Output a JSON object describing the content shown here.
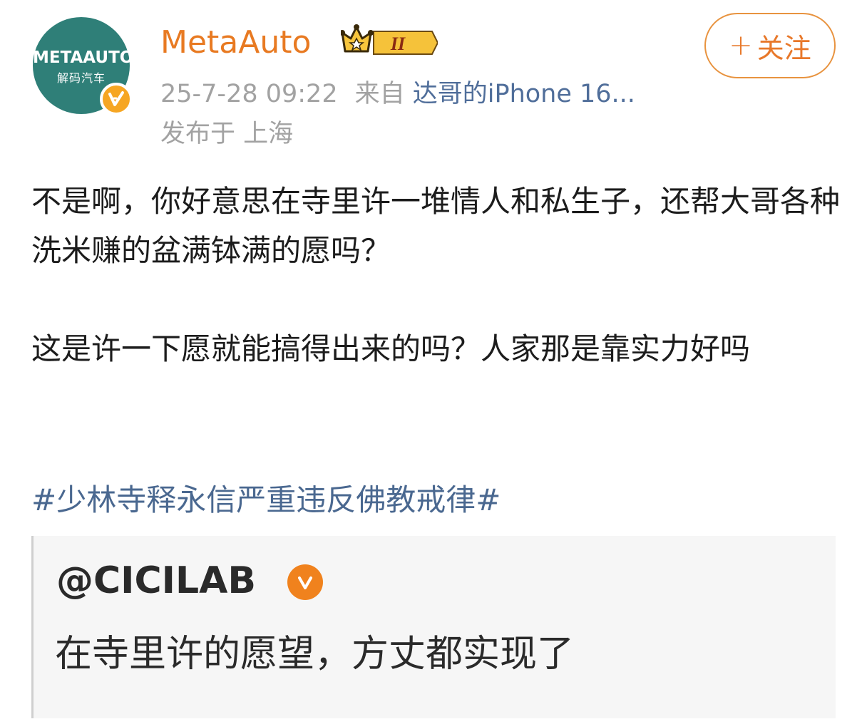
{
  "author": {
    "name": "MetaAuto",
    "avatar_logo_line1": "METAAUTO",
    "avatar_logo_line2": "解码汽车",
    "level_badge": "II"
  },
  "follow_button": {
    "plus": "+",
    "label": "关注"
  },
  "meta": {
    "timestamp": "25-7-28 09:22",
    "source_prefix": "来自",
    "device": "达哥的iPhone 16...",
    "location": "发布于 上海"
  },
  "post": {
    "paragraph1": "不是啊，你好意思在寺里许一堆情人和私生子，还帮大哥各种洗米赚的盆满钵满的愿吗？",
    "paragraph2": "这是许一下愿就能搞得出来的吗？人家那是靠实力好吗",
    "hashtag": "#少林寺释永信严重违反佛教戒律#"
  },
  "quote": {
    "user": "@CICILAB",
    "text": "在寺里许的愿望，方丈都实现了"
  },
  "colors": {
    "username": "#e87a22",
    "link": "#4a6890",
    "follow": "#e8782a",
    "verified_badge": "#f0821d",
    "avatar_bg": "#2f7f78"
  },
  "icons": {
    "verified": "verified-v-icon",
    "crown": "crown-level-icon"
  }
}
